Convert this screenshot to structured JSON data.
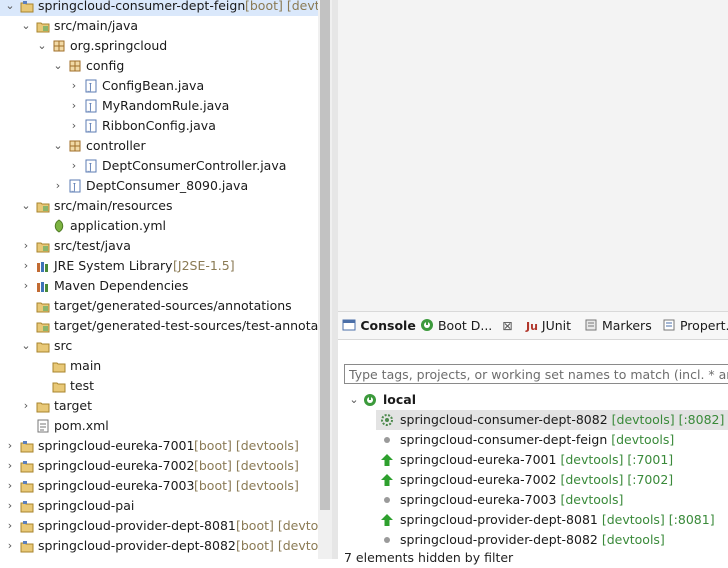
{
  "explorer": {
    "rows": [
      {
        "label": "springcloud-consumer-dept-feign",
        "dec": " [boot] [devtools]",
        "icon": "project-icon",
        "arrow": "open",
        "selected": true
      },
      {
        "label": "src/main/java",
        "icon": "source-folder-icon",
        "arrow": "open"
      },
      {
        "label": "org.springcloud",
        "icon": "package-icon",
        "arrow": "open"
      },
      {
        "label": "config",
        "icon": "package-icon",
        "arrow": "open"
      },
      {
        "label": "ConfigBean.java",
        "icon": "java-file-icon",
        "arrow": "closed"
      },
      {
        "label": "MyRandomRule.java",
        "icon": "java-file-icon",
        "arrow": "closed"
      },
      {
        "label": "RibbonConfig.java",
        "icon": "java-file-icon",
        "arrow": "closed"
      },
      {
        "label": "controller",
        "icon": "package-icon",
        "arrow": "open"
      },
      {
        "label": "DeptConsumerController.java",
        "icon": "java-file-icon",
        "arrow": "closed"
      },
      {
        "label": "DeptConsumer_8090.java",
        "icon": "java-file-icon",
        "arrow": "closed"
      },
      {
        "label": "src/main/resources",
        "icon": "source-folder-icon",
        "arrow": "open"
      },
      {
        "label": "application.yml",
        "icon": "yml-file-icon",
        "arrow": "none"
      },
      {
        "label": "src/test/java",
        "icon": "source-folder-icon",
        "arrow": "closed"
      },
      {
        "label": "JRE System Library",
        "dec": " [J2SE-1.5]",
        "icon": "library-icon",
        "arrow": "closed"
      },
      {
        "label": "Maven Dependencies",
        "icon": "library-icon",
        "arrow": "closed"
      },
      {
        "label": "target/generated-sources/annotations",
        "icon": "source-folder-icon",
        "arrow": "none"
      },
      {
        "label": "target/generated-test-sources/test-annotations",
        "icon": "source-folder-icon",
        "arrow": "none"
      },
      {
        "label": "src",
        "icon": "folder-icon",
        "arrow": "open"
      },
      {
        "label": "main",
        "icon": "folder-icon",
        "arrow": "none"
      },
      {
        "label": "test",
        "icon": "folder-icon",
        "arrow": "none"
      },
      {
        "label": "target",
        "icon": "folder-icon",
        "arrow": "closed"
      },
      {
        "label": "pom.xml",
        "icon": "xml-file-icon",
        "arrow": "none"
      },
      {
        "label": "springcloud-eureka-7001",
        "dec": " [boot] [devtools]",
        "icon": "project-icon",
        "arrow": "closed"
      },
      {
        "label": "springcloud-eureka-7002",
        "dec": " [boot] [devtools]",
        "icon": "project-icon",
        "arrow": "closed"
      },
      {
        "label": "springcloud-eureka-7003",
        "dec": " [boot] [devtools]",
        "icon": "project-icon",
        "arrow": "closed"
      },
      {
        "label": "springcloud-pai",
        "icon": "project-icon",
        "arrow": "closed"
      },
      {
        "label": "springcloud-provider-dept-8081",
        "dec": " [boot] [devtools]",
        "icon": "project-icon",
        "arrow": "closed"
      },
      {
        "label": "springcloud-provider-dept-8082",
        "dec": " [boot] [devtools]",
        "icon": "project-icon",
        "arrow": "closed"
      }
    ]
  },
  "tabs": [
    {
      "label": "Console",
      "icon": "console-icon",
      "active": true
    },
    {
      "label": "Boot D...",
      "icon": "boot-dashboard-icon",
      "close": "⊠"
    },
    {
      "label": "JUnit",
      "icon": "junit-icon"
    },
    {
      "label": "Markers",
      "icon": "markers-icon"
    },
    {
      "label": "Propert.",
      "icon": "properties-icon"
    }
  ],
  "dashboard": {
    "filter_placeholder": "Type tags, projects, or working set names to match (incl. * and ? wildcards)",
    "group_label": "local",
    "apps": [
      {
        "name": "springcloud-consumer-dept-8082",
        "tags": "[devtools]",
        "port": "[:8082]",
        "status": "starting",
        "selected": true
      },
      {
        "name": "springcloud-consumer-dept-feign",
        "tags": "[devtools]",
        "port": "",
        "status": "stopped"
      },
      {
        "name": "springcloud-eureka-7001",
        "tags": "[devtools]",
        "port": "[:7001]",
        "status": "running"
      },
      {
        "name": "springcloud-eureka-7002",
        "tags": "[devtools]",
        "port": "[:7002]",
        "status": "running"
      },
      {
        "name": "springcloud-eureka-7003",
        "tags": "[devtools]",
        "port": "",
        "status": "stopped"
      },
      {
        "name": "springcloud-provider-dept-8081",
        "tags": "[devtools]",
        "port": "[:8081]",
        "status": "running"
      },
      {
        "name": "springcloud-provider-dept-8082",
        "tags": "[devtools]",
        "port": "",
        "status": "stopped"
      }
    ],
    "hidden_text": "7 elements hidden by filter"
  },
  "colors": {
    "selection": "#dae8fb",
    "running": "#2ea02e",
    "tag": "#3a8a3a",
    "decoration": "#8a7a54"
  }
}
